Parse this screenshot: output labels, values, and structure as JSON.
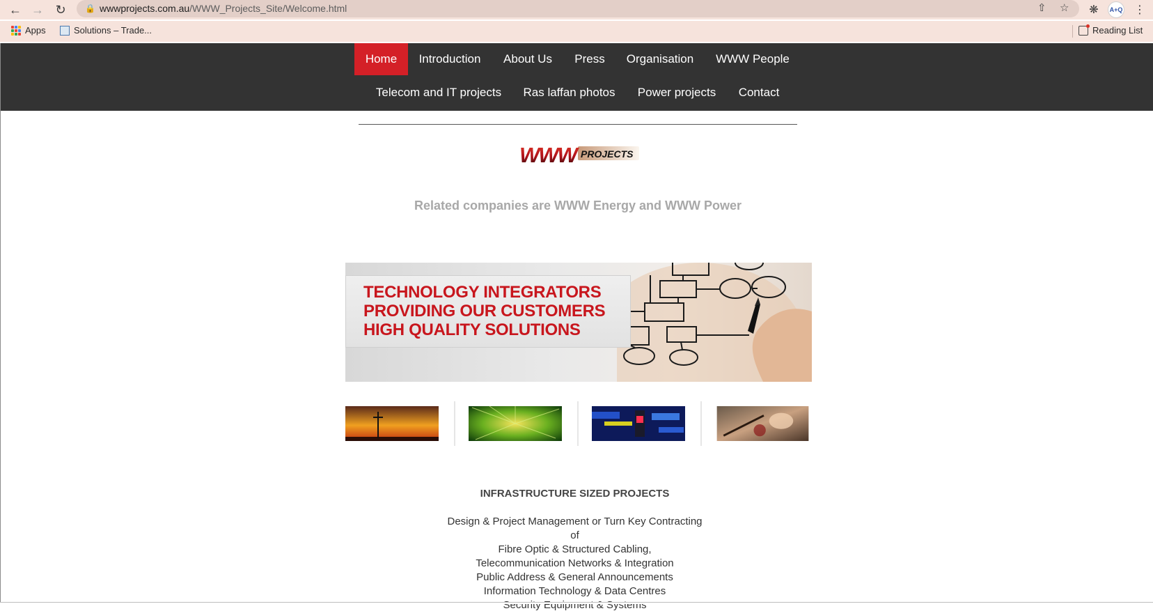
{
  "browser": {
    "url_domain": "wwwprojects.com.au",
    "url_path": "/WWW_Projects_Site/Welcome.html",
    "avatar_text": "A+Q",
    "bookmarks": [
      {
        "label": "Apps",
        "icon": "apps-grid-icon"
      },
      {
        "label": "Solutions – Trade...",
        "icon": "site-favicon"
      }
    ],
    "reading_list_label": "Reading List"
  },
  "nav": {
    "row1": [
      "Home",
      "Introduction",
      "About Us",
      "Press",
      "Organisation",
      "WWW People"
    ],
    "row2": [
      "Telecom and IT projects",
      "Ras laffan photos",
      "Power projects",
      "Contact"
    ],
    "active": "Home"
  },
  "logo": {
    "text_www": "WWW",
    "text_projects": "PROJECTS"
  },
  "related_text": "Related companies are WWW Energy and WWW Power",
  "banner": {
    "lines": [
      "TECHNOLOGY INTEGRATORS",
      "PROVIDING OUR CUSTOMERS",
      "HIGH QUALITY SOLUTIONS"
    ]
  },
  "content": {
    "headline": "INFRASTRUCTURE SIZED PROJECTS",
    "lines": [
      "Design & Project Management or Turn Key Contracting",
      "of",
      "Fibre Optic & Structured Cabling,",
      "Telecommunication Networks & Integration",
      "Public Address & General Announcements",
      "Information Technology & Data Centres",
      "Security Equipment & Systems"
    ]
  },
  "colors": {
    "nav_bg": "#333333",
    "nav_active": "#d42027",
    "banner_text": "#c8161d",
    "related_text": "#a8a8a8"
  }
}
